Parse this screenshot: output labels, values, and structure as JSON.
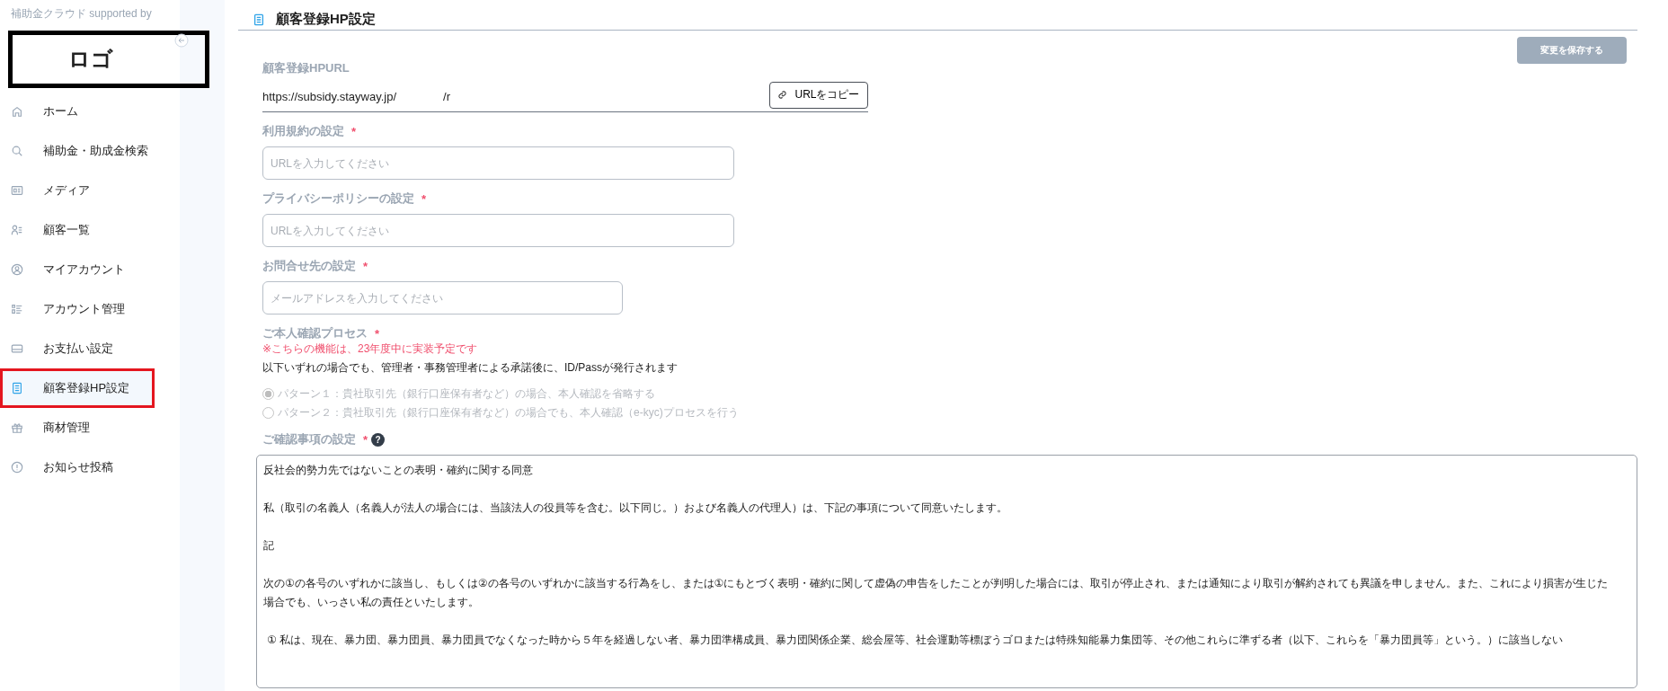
{
  "sidebar": {
    "brand_caption": "補助金クラウド supported by",
    "logo": "ロゴ",
    "items": [
      {
        "label": "ホーム",
        "selected": false
      },
      {
        "label": "補助金・助成金検索",
        "selected": false
      },
      {
        "label": "メディア",
        "selected": false
      },
      {
        "label": "顧客一覧",
        "selected": false
      },
      {
        "label": "マイアカウント",
        "selected": false
      },
      {
        "label": "アカウント管理",
        "selected": false
      },
      {
        "label": "お支払い設定",
        "selected": false
      },
      {
        "label": "顧客登録HP設定",
        "selected": true
      },
      {
        "label": "商材管理",
        "selected": false
      },
      {
        "label": "お知らせ投稿",
        "selected": false
      }
    ]
  },
  "page": {
    "title": "顧客登録HP設定",
    "save_button": {
      "label": "変更を保存する",
      "disabled": true
    },
    "url_section": {
      "label": "顧客登録HPURL",
      "value_parts": [
        "https://subsidy.stayway.jp/",
        "/r"
      ],
      "copy_button": "URLをコピー"
    },
    "fields": [
      {
        "label": "利用規約の設定",
        "required_mark": "*",
        "placeholder": "URLを入力してください",
        "wide": true
      },
      {
        "label": "プライバシーポリシーの設定",
        "required_mark": "*",
        "placeholder": "URLを入力してください",
        "wide": true
      },
      {
        "label": "お問合せ先の設定",
        "required_mark": "*",
        "placeholder": "メールアドレスを入力してください",
        "wide": false
      }
    ],
    "identity": {
      "label": "ご本人確認プロセス",
      "required_mark": "*",
      "notice": "※こちらの機能は、23年度中に実装予定です",
      "description": "以下いずれの場合でも、管理者・事務管理者による承諾後に、ID/Passが発行されます",
      "options": [
        {
          "label": "パターン１：貴社取引先（銀行口座保有者など）の場合、本人確認を省略する",
          "selected": true,
          "disabled": true
        },
        {
          "label": "パターン２：貴社取引先（銀行口座保有者など）の場合でも、本人確認（e-kyc)プロセスを行う",
          "selected": false,
          "disabled": true
        }
      ]
    },
    "confirmation": {
      "label": "ご確認事項の設定",
      "required_mark": "*",
      "help": "?",
      "paragraphs": [
        "反社会的勢力先ではないことの表明・確約に関する同意",
        "私（取引の名義人（名義人が法人の場合には、当該法人の役員等を含む。以下同じ。）および名義人の代理人）は、下記の事項について同意いたします。",
        "記",
        "次の①の各号のいずれかに該当し、もしくは②の各号のいずれかに該当する行為をし、または①にもとづく表明・確約に関して虚偽の申告をしたことが判明した場合には、取引が停止され、または通知により取引が解約されても異議を申しません。また、これにより損害が生じた場合でも、いっさい私の責任といたします。",
        "① 私は、現在、暴力団、暴力団員、暴力団員でなくなった時から５年を経過しない者、暴力団準構成員、暴力団関係企業、総会屋等、社会運動等標ぼうゴロまたは特殊知能暴力集団等、その他これらに準ずる者（以下、これらを「暴力団員等」という。）に該当しない"
      ]
    }
  }
}
